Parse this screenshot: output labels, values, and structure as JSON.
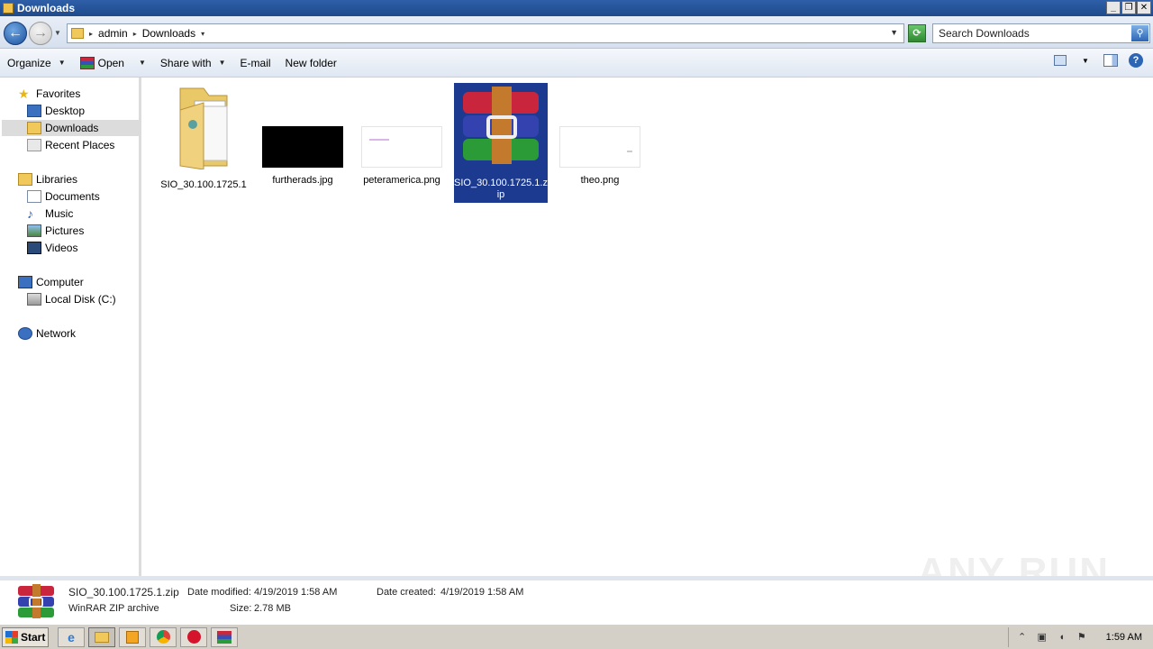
{
  "window": {
    "title": "Downloads"
  },
  "address": {
    "crumbs": [
      "admin",
      "Downloads"
    ]
  },
  "search": {
    "placeholder": "Search Downloads"
  },
  "toolbar": {
    "organize": "Organize",
    "open": "Open",
    "share_with": "Share with",
    "email": "E-mail",
    "new_folder": "New folder"
  },
  "nav": {
    "favorites": "Favorites",
    "desktop": "Desktop",
    "downloads": "Downloads",
    "recent_places": "Recent Places",
    "libraries": "Libraries",
    "documents": "Documents",
    "music": "Music",
    "pictures": "Pictures",
    "videos": "Videos",
    "computer": "Computer",
    "local_disk": "Local Disk (C:)",
    "network": "Network"
  },
  "files": [
    {
      "name": "SIO_30.100.1725.1",
      "type": "folder"
    },
    {
      "name": "furtherads.jpg",
      "type": "image-black"
    },
    {
      "name": "peteramerica.png",
      "type": "image-white"
    },
    {
      "name": "SIO_30.100.1725.1.zip",
      "type": "winrar",
      "selected": true
    },
    {
      "name": "theo.png",
      "type": "image-white"
    }
  ],
  "details": {
    "name": "SIO_30.100.1725.1.zip",
    "type": "WinRAR ZIP archive",
    "modified_label": "Date modified:",
    "modified_value": "4/19/2019 1:58 AM",
    "created_label": "Date created:",
    "created_value": "4/19/2019 1:58 AM",
    "size_label": "Size:",
    "size_value": "2.78 MB"
  },
  "watermark": "ANY RUN",
  "taskbar": {
    "start": "Start",
    "clock": "1:59 AM"
  }
}
